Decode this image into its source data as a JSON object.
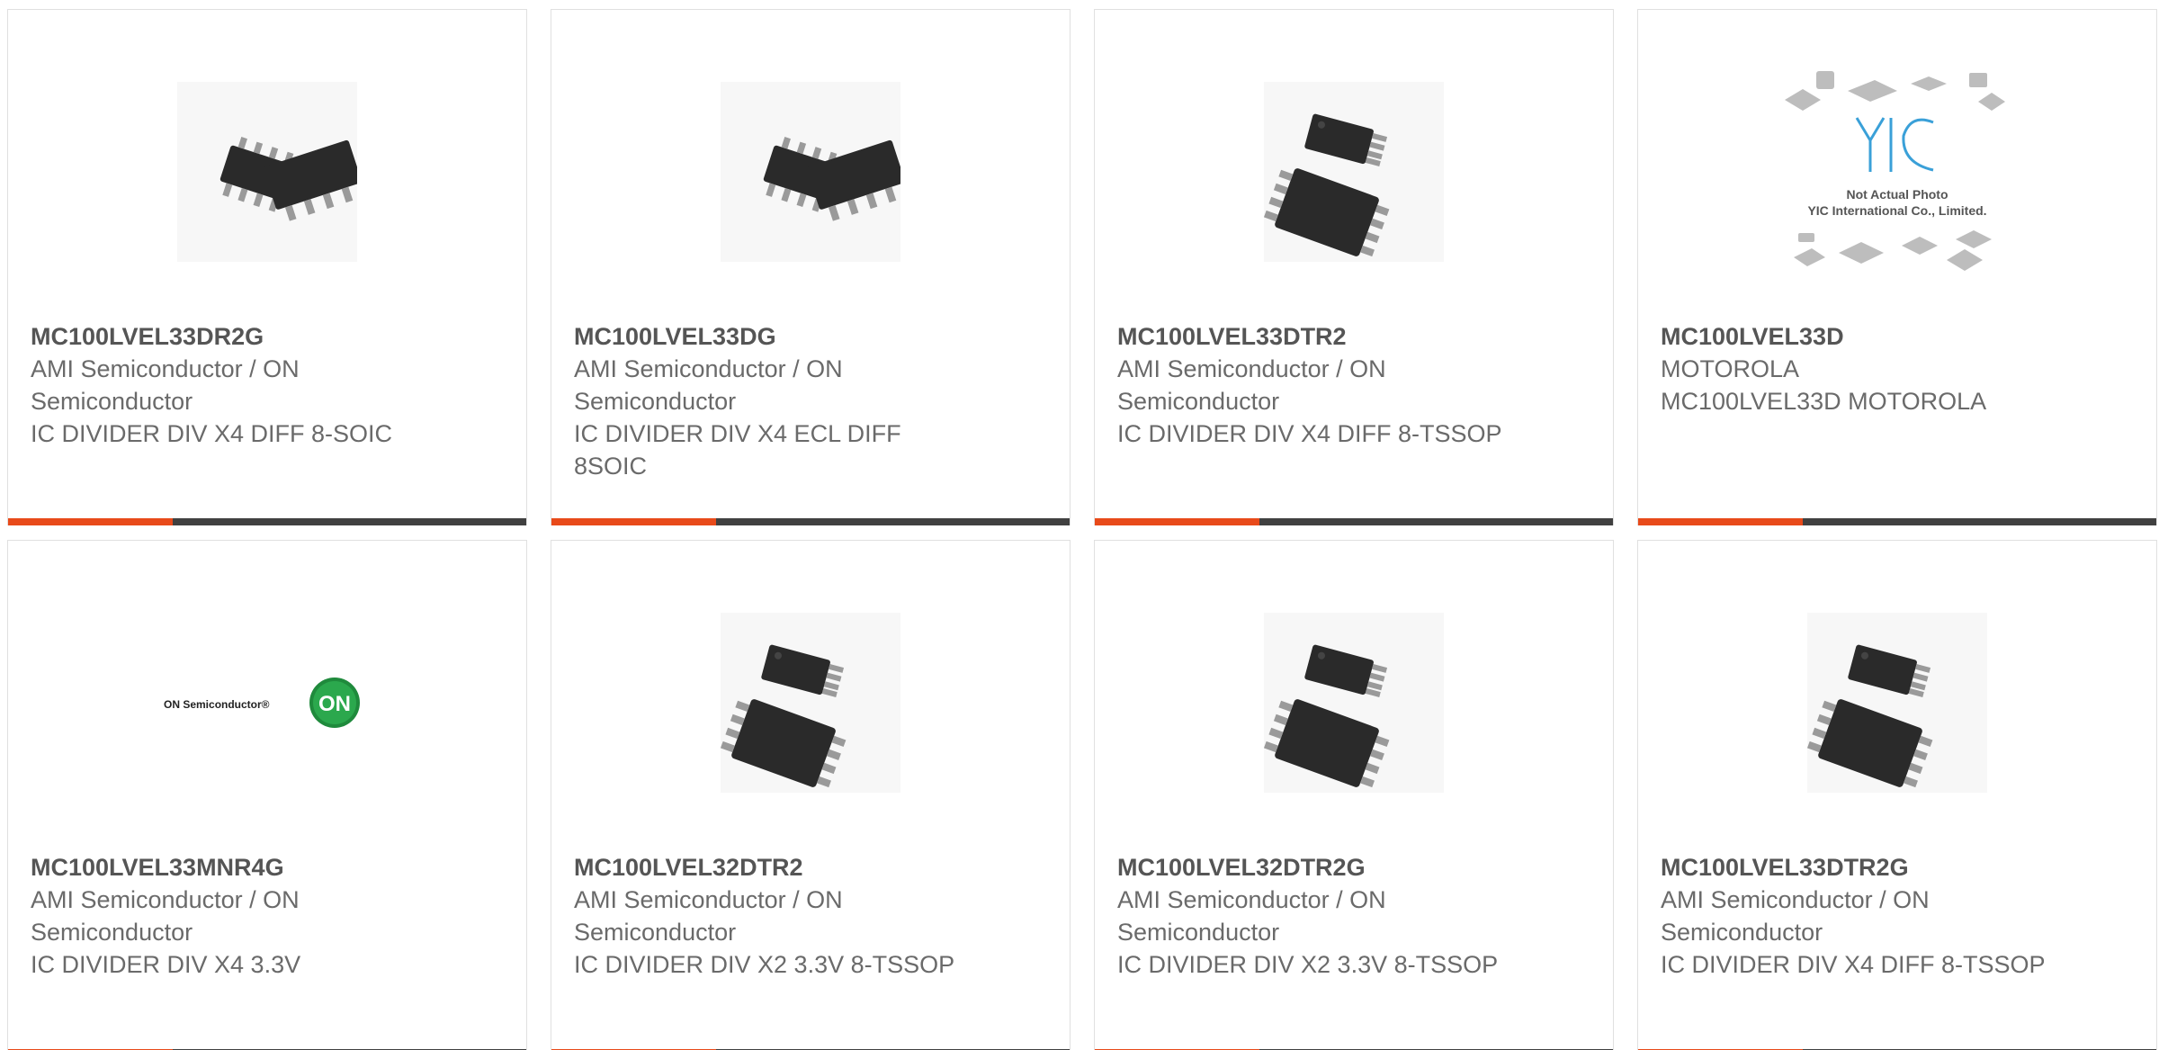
{
  "accent_color": "#e84a1a",
  "bar_color": "#404040",
  "products": [
    {
      "part": "MC100LVEL33DR2G",
      "manufacturer": "AMI Semiconductor / ON Semiconductor",
      "description": "IC DIVIDER DIV X4 DIFF 8-SOIC",
      "image": "soic-chip-icon"
    },
    {
      "part": "MC100LVEL33DG",
      "manufacturer": "AMI Semiconductor / ON Semiconductor",
      "description": "IC DIVIDER DIV X4 ECL DIFF 8SOIC",
      "image": "soic-chip-icon"
    },
    {
      "part": "MC100LVEL33DTR2",
      "manufacturer": "AMI Semiconductor / ON Semiconductor",
      "description": "IC DIVIDER DIV X4 DIFF 8-TSSOP",
      "image": "tssop-chip-icon"
    },
    {
      "part": "MC100LVEL33D",
      "manufacturer": "MOTOROLA",
      "description": "MC100LVEL33D MOTOROLA",
      "image": "yic-placeholder-image",
      "placeholder_text": [
        "Not Actual Photo",
        "YIC International Co., Limited."
      ]
    },
    {
      "part": "MC100LVEL33MNR4G",
      "manufacturer": "AMI Semiconductor / ON Semiconductor",
      "description": "IC DIVIDER DIV X4 3.3V",
      "image": "on-semiconductor-logo",
      "logo_text": "ON Semiconductor®",
      "logo_badge": "ON"
    },
    {
      "part": "MC100LVEL32DTR2",
      "manufacturer": "AMI Semiconductor / ON Semiconductor",
      "description": "IC DIVIDER DIV X2 3.3V 8-TSSOP",
      "image": "tssop-chip-icon"
    },
    {
      "part": "MC100LVEL32DTR2G",
      "manufacturer": "AMI Semiconductor / ON Semiconductor",
      "description": "IC DIVIDER DIV X2 3.3V 8-TSSOP",
      "image": "tssop-chip-icon"
    },
    {
      "part": "MC100LVEL33DTR2G",
      "manufacturer": "AMI Semiconductor / ON Semiconductor",
      "description": "IC DIVIDER DIV X4 DIFF 8-TSSOP",
      "image": "tssop-chip-icon"
    }
  ]
}
